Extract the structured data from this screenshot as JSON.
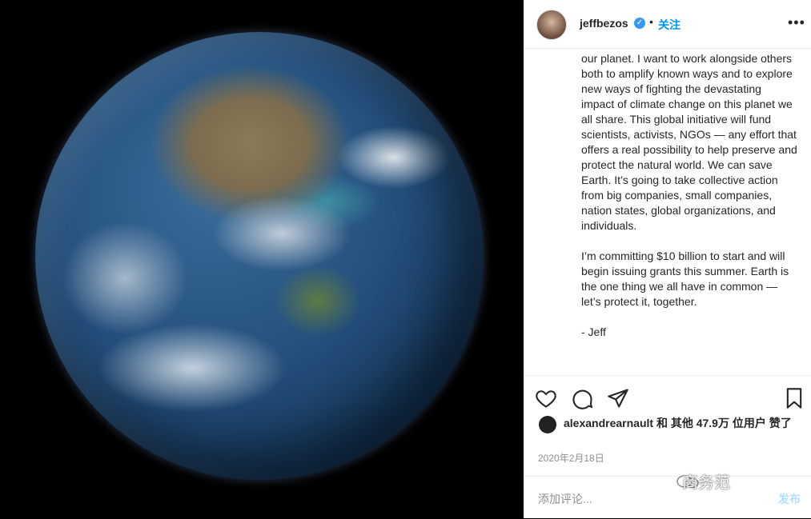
{
  "post": {
    "username": "jeffbezos",
    "separator": "•",
    "follow_label": "关注",
    "more_label": "•••",
    "caption": "our planet. I want to work alongside others both to amplify known ways and to explore new ways of fighting the devastating impact of climate change on this planet we all share. This global initiative will fund scientists, activists, NGOs — any effort that offers a real possibility to help preserve and protect the natural world. We can save Earth. It’s going to take collective action from big companies, small companies, nation states, global organizations, and individuals.\n\nI’m committing $10 billion to start and will begin issuing grants this summer. Earth is the one thing we all have in common — let’s protect it, together.\n\n- Jeff",
    "likes_text": "alexandrearnault 和 其他 47.9万 位用户 赞了",
    "date": "2020年2月18日",
    "comment_placeholder": "添加评论...",
    "post_label": "发布",
    "watermark": "商务范"
  },
  "icons": [
    "verified-badge-icon",
    "heart-icon",
    "comment-icon",
    "share-icon",
    "bookmark-icon"
  ],
  "colors": {
    "accent": "#0095f6",
    "text": "#262626",
    "muted": "#8e8e8e"
  }
}
